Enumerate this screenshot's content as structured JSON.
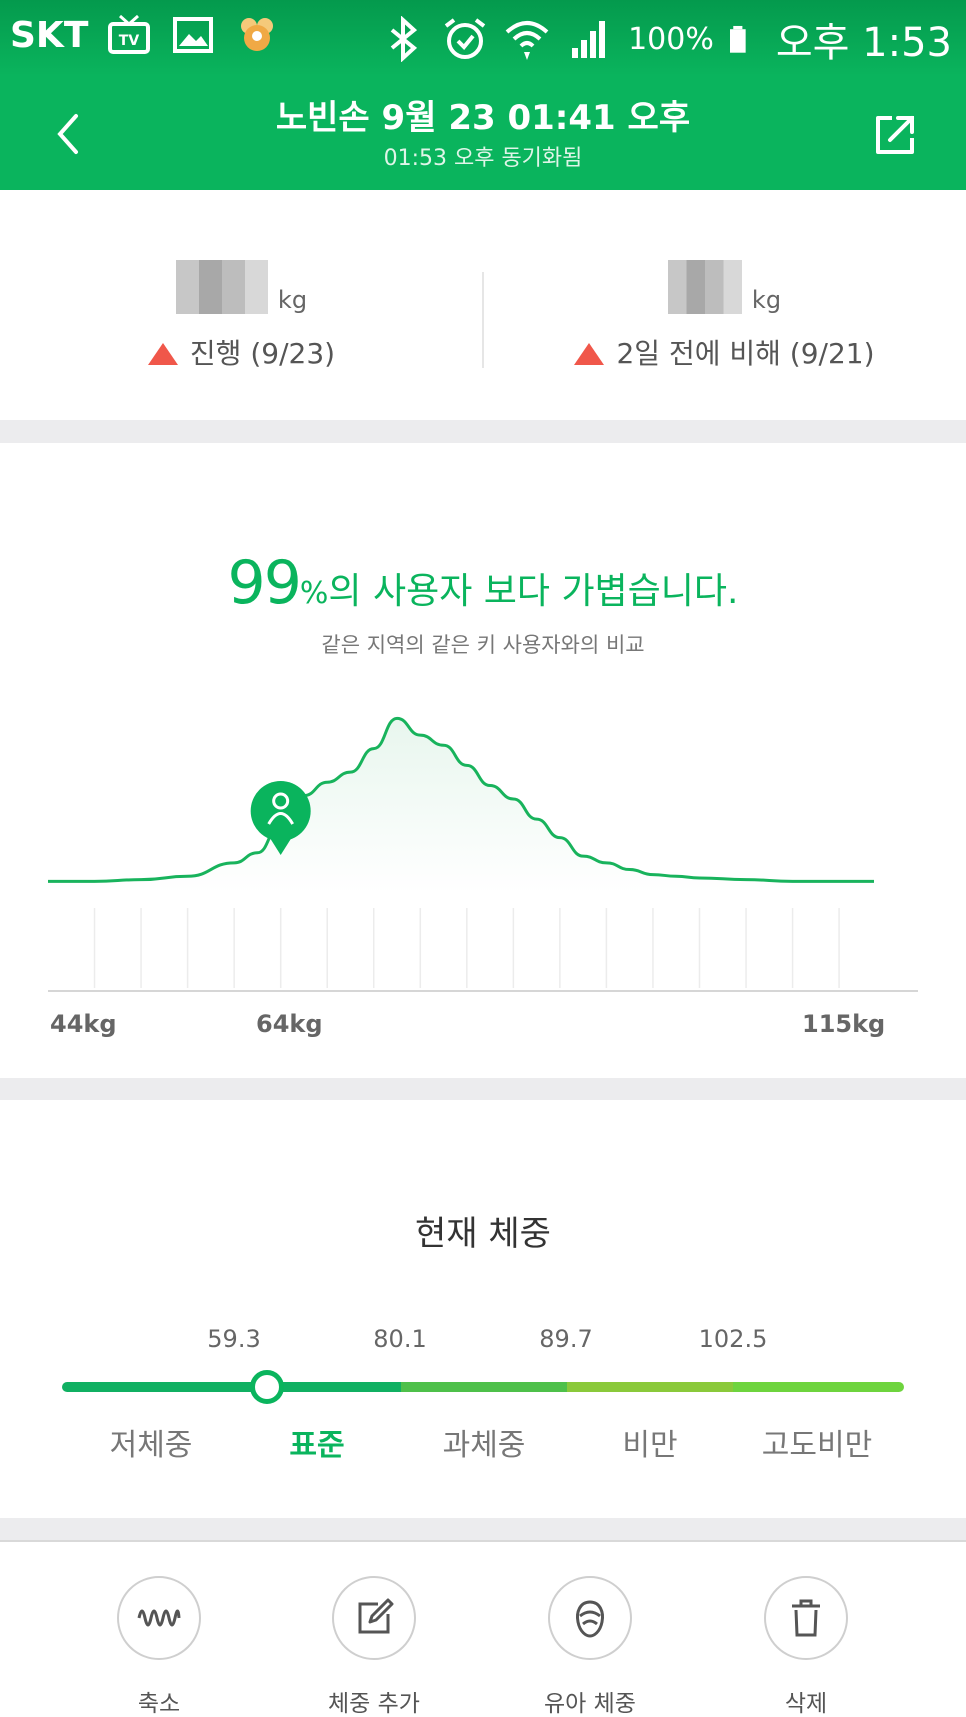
{
  "status_bar": {
    "carrier": "SKT",
    "battery": "100%",
    "time": "오후 1:53",
    "icons": [
      "tv-icon",
      "gallery-icon",
      "app-icon",
      "bluetooth-icon",
      "alarm-icon",
      "wifi-icon",
      "signal-icon",
      "battery-icon"
    ]
  },
  "header": {
    "title": "노빈손 9월 23 01:41 오후",
    "subtitle": "01:53 오후 동기화됨",
    "back_icon": "chevron-left-icon",
    "share_icon": "share-icon"
  },
  "summary": {
    "left": {
      "unit": "kg",
      "change_label": "진행 (9/23)"
    },
    "right": {
      "unit": "kg",
      "change_label": "2일 전에 비해 (9/21)"
    }
  },
  "distribution": {
    "percent": "99",
    "percent_sign": "%",
    "headline_rest": "의 사용자 보다 가볍습니다.",
    "subtitle": "같은 지역의 같은 키 사용자와의 비교",
    "x_labels": {
      "min": "44kg",
      "user": "64kg",
      "max": "115kg"
    }
  },
  "chart_data": {
    "type": "area",
    "xlim": [
      44,
      115
    ],
    "x": [
      44,
      48,
      52,
      56,
      60,
      62,
      64,
      66,
      68,
      70,
      72,
      74,
      76,
      78,
      80,
      82,
      84,
      86,
      88,
      90,
      92,
      94,
      96,
      98,
      100,
      104,
      108,
      112,
      115
    ],
    "y": [
      0.01,
      0.01,
      0.02,
      0.04,
      0.12,
      0.18,
      0.35,
      0.52,
      0.6,
      0.66,
      0.8,
      0.98,
      0.88,
      0.82,
      0.7,
      0.58,
      0.5,
      0.38,
      0.27,
      0.16,
      0.12,
      0.08,
      0.05,
      0.04,
      0.03,
      0.02,
      0.01,
      0.01,
      0.01
    ],
    "user_marker_x": 64,
    "grid": true,
    "colors": {
      "line": "#18b35c",
      "fill": "#e8f6ee",
      "marker": "#0ab45d"
    }
  },
  "current_weight": {
    "title": "현재 체중",
    "thresholds": [
      "59.3",
      "80.1",
      "89.7",
      "102.5"
    ],
    "categories": [
      "저체중",
      "표준",
      "과체중",
      "비만",
      "고도비만"
    ],
    "active_category": "표준",
    "colors": [
      "#10b062",
      "#10b062",
      "#4ec04a",
      "#8ac93a",
      "#6ed43e"
    ]
  },
  "actions": [
    {
      "label": "축소",
      "icon": "wave-icon"
    },
    {
      "label": "체중 추가",
      "icon": "edit-icon"
    },
    {
      "label": "유아 체중",
      "icon": "baby-icon"
    },
    {
      "label": "삭제",
      "icon": "trash-icon"
    }
  ]
}
